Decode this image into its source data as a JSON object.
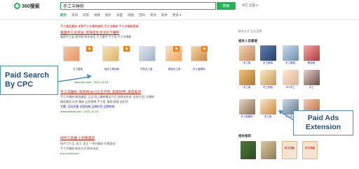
{
  "header": {
    "logo_text": "360搜索",
    "query": "手工羊睡粉",
    "search_button": "搜索",
    "links": "找它 全部 ▾"
  },
  "nav": {
    "tabs": [
      "网页",
      "资讯",
      "问答",
      "视频",
      "图片",
      "良医",
      "地图",
      "百科",
      "英文",
      "软件",
      "更多 ▾"
    ]
  },
  "results": {
    "ad_links": "手工美容美体 求购手工羊睡粉缩短 手工羊睡粉 手工羊睡粉直销",
    "ad1_title": "美国手工皂批发_有限度生活活动下睡积",
    "ad1_snippet": "美国手工皂 提供商 联系电话 手工美甲 手工皂 手工羊睡粉",
    "thumbs": [
      "手工香皂",
      "纯手工精油皂",
      "羊奶手工皂",
      "精油手工皂",
      "手工皂原料"
    ],
    "ad1_url": "www.xxx.com · 2021-11-03",
    "ad2_title": "手工羊睡粉_淘宝网(317)正在开售_超级好用, 速度发货",
    "ad2_snippet_1": "手工羊睡粉 精选美容. 正品 网上最新最全产品 选择适合你. 支持 行货 羊睡粉",
    "ad2_snippet_2": "精选美容 好货 最新 品质保障 手工皂. 美容 超值 选好货",
    "ad2_links": "专题: 活动优惠  全国包邮  品牌好货  品牌热销",
    "ad2_url": "www.taobao.com · 2021-11-03",
    "org_title": "纯手工羊睡 上到哪里买",
    "org_snippet_1": "纯手工产品. 加工. 加工.一系列服务 价格面议",
    "org_snippet_2": "手工羊睡粉 联系方式 联系电话",
    "org_url": "k.so.com/xxxxx"
  },
  "sidebar": {
    "tab": "联系方式   企业品牌",
    "head1": "相关人员都搜",
    "grid_captions": [
      "手工皂",
      "手工精油",
      "手工香皂",
      "精油皂",
      "手工皂",
      "手工饰品",
      "DIY手工",
      "手工",
      "手工皂原料",
      "手工皂",
      "手工布艺",
      "primark"
    ],
    "head2": "相关推荐",
    "book_labels": [
      "手工作品",
      "手工作品"
    ]
  },
  "callouts": {
    "paid_search_line1": "Paid Search",
    "paid_search_line2": "By CPC",
    "paid_ads_line1": "Paid Ads",
    "paid_ads_line2": "Extension"
  }
}
